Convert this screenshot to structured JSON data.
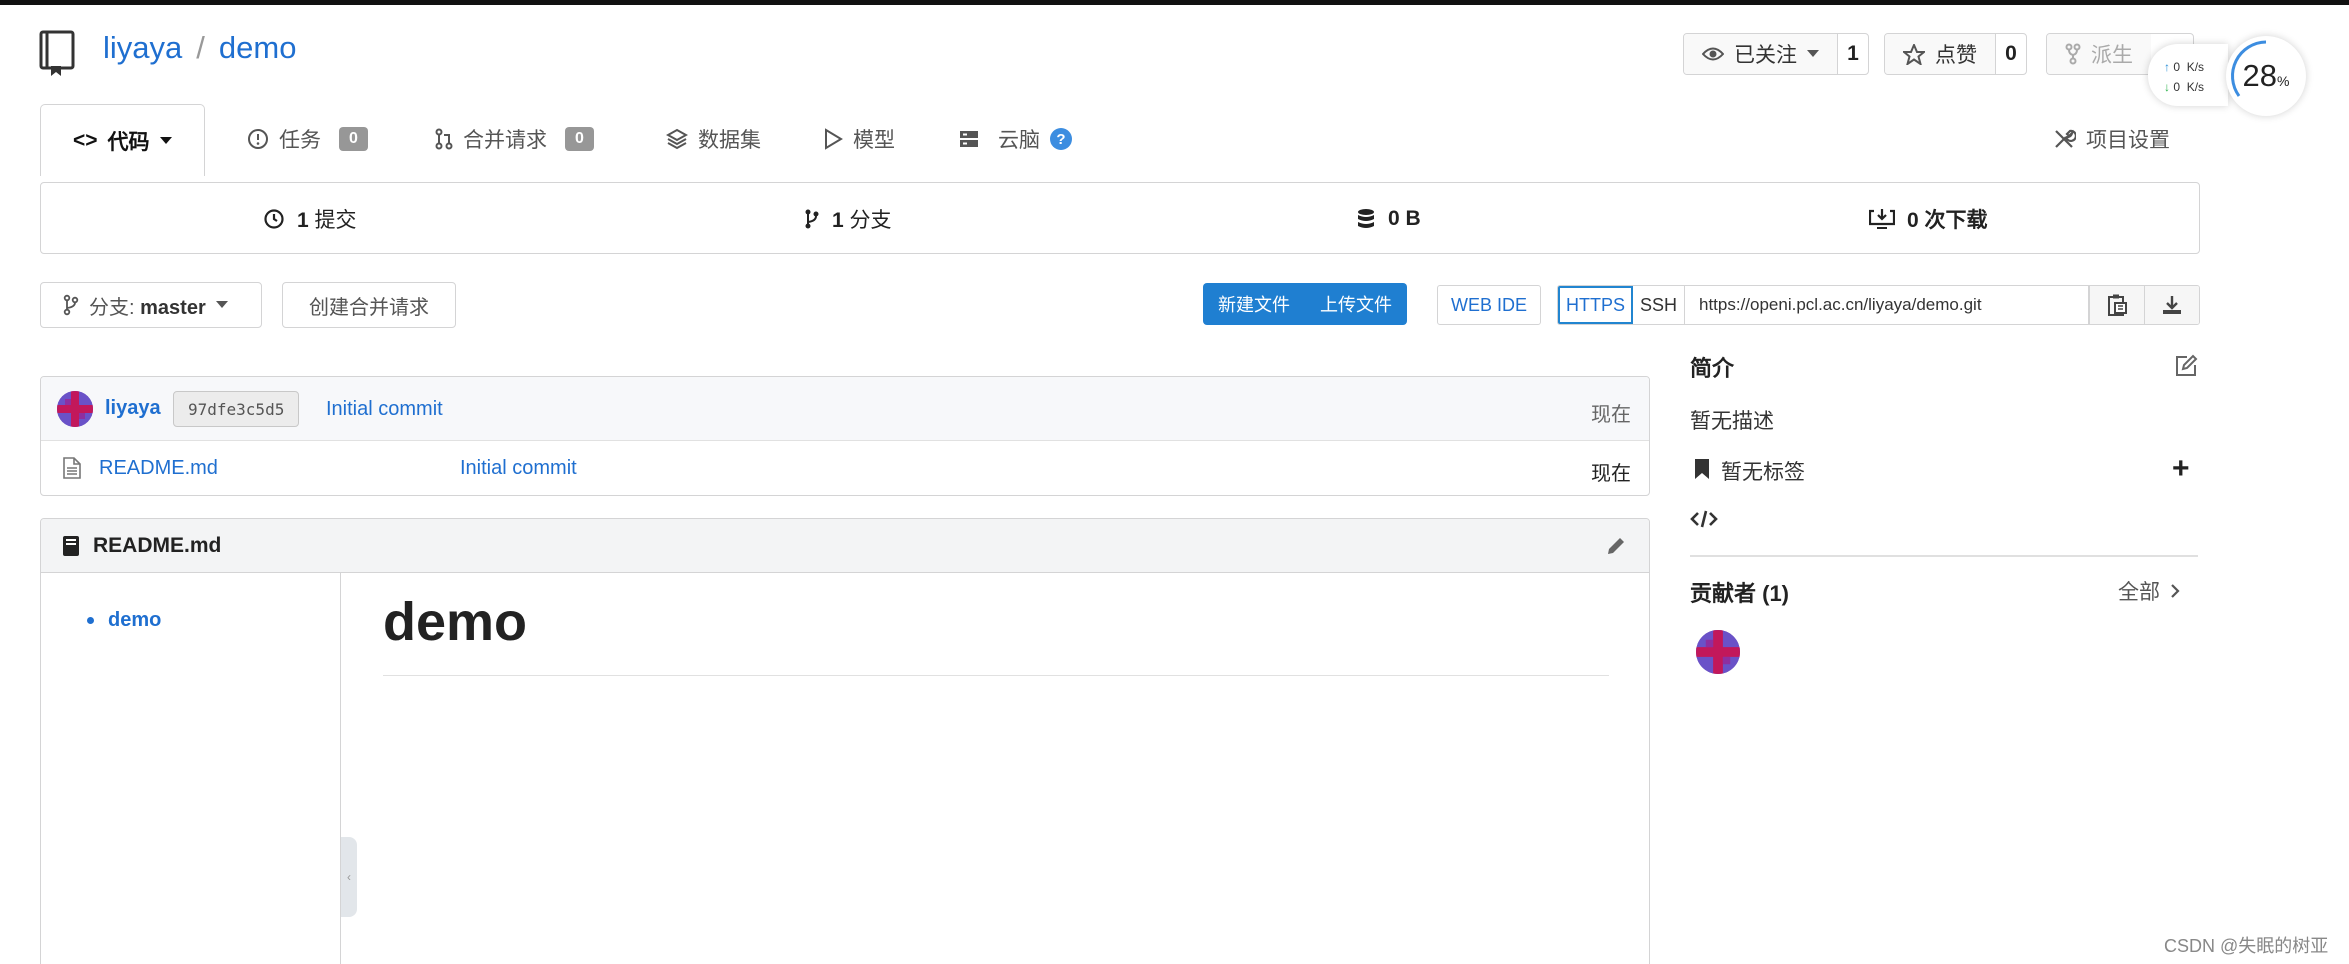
{
  "repo": {
    "owner": "liyaya",
    "separator": "/",
    "name": "demo"
  },
  "header_actions": {
    "watch": {
      "label": "已关注",
      "count": "1"
    },
    "star": {
      "label": "点赞",
      "count": "0"
    },
    "fork": {
      "label": "派生"
    }
  },
  "net_monitor": {
    "up_value": "0",
    "up_unit": "K/s",
    "down_value": "0",
    "down_unit": "K/s",
    "percent": "28",
    "percent_sign": "%"
  },
  "tabs": [
    {
      "label": "代码",
      "active": true
    },
    {
      "label": "任务",
      "count": "0"
    },
    {
      "label": "合并请求",
      "count": "0"
    },
    {
      "label": "数据集"
    },
    {
      "label": "模型"
    },
    {
      "label": "云脑",
      "help": "?"
    }
  ],
  "settings_tab": {
    "label": "项目设置"
  },
  "stats": {
    "commits": {
      "count": "1",
      "label": "提交"
    },
    "branches": {
      "count": "1",
      "label": "分支"
    },
    "size": {
      "value": "0 B"
    },
    "downloads": {
      "text": "0 次下载"
    }
  },
  "toolbar": {
    "branch_prefix": "分支:",
    "branch_name": "master",
    "create_pr": "创建合并请求",
    "new_file": "新建文件",
    "upload_file": "上传文件",
    "web_ide": "WEB IDE",
    "https": "HTTPS",
    "ssh": "SSH",
    "clone_url": "https://openi.pcl.ac.cn/liyaya/demo.git"
  },
  "latest_commit": {
    "author": "liyaya",
    "sha": "97dfe3c5d5",
    "message": "Initial commit",
    "time": "现在"
  },
  "files": [
    {
      "name": "README.md",
      "message": "Initial commit",
      "time": "现在"
    }
  ],
  "readme": {
    "filename": "README.md",
    "toc": [
      "demo"
    ],
    "heading": "demo"
  },
  "sidebar": {
    "about_title": "简介",
    "description": "暂无描述",
    "tags": "暂无标签",
    "contributors_title": "贡献者 (1)",
    "contributors_all": "全部"
  },
  "watermark": "CSDN @失眠的树亚",
  "colors": {
    "link": "#1f6fd0",
    "primary_button": "#1f7fd1",
    "badge": "#979797"
  }
}
